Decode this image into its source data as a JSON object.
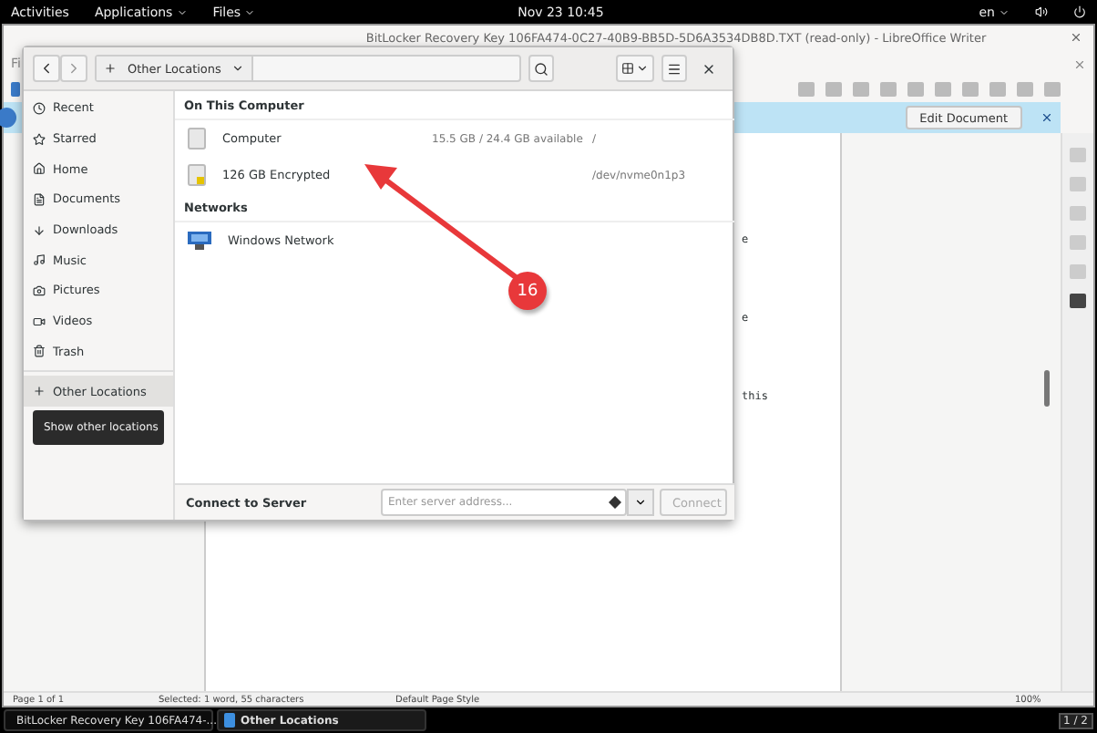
{
  "top_bar": {
    "activities": "Activities",
    "applications": "Applications",
    "app_menu": "Files",
    "clock": "Nov 23  10:45",
    "language": "en"
  },
  "writer": {
    "title": "BitLocker Recovery Key 106FA474-0C27-40B9-BB5D-5D6A3534DB8D.TXT (read-only) - LibreOffice Writer",
    "menu": "Fi",
    "infobar": {
      "button": "Edit Document"
    },
    "page_text": [
      "e",
      "e",
      "this"
    ],
    "status_bar": {
      "page": "Page 1 of 1",
      "selection": "Selected: 1 word, 55 characters",
      "style": "Default Page Style",
      "zoom": "100%"
    }
  },
  "files_dialog": {
    "path": "Other Locations",
    "sidebar": [
      {
        "label": "Recent",
        "selected": false
      },
      {
        "label": "Starred",
        "selected": false
      },
      {
        "label": "Home",
        "selected": false
      },
      {
        "label": "Documents",
        "selected": false
      },
      {
        "label": "Downloads",
        "selected": false
      },
      {
        "label": "Music",
        "selected": false
      },
      {
        "label": "Pictures",
        "selected": false
      },
      {
        "label": "Videos",
        "selected": false
      },
      {
        "label": "Trash",
        "selected": false
      },
      {
        "label": "Other Locations",
        "selected": true
      }
    ],
    "tooltip": "Show other locations",
    "sections": [
      {
        "title": "On This Computer",
        "items": [
          {
            "kind": "drive",
            "name": "Computer",
            "space": "15.5 GB / 24.4 GB available",
            "mount": "/"
          },
          {
            "kind": "locked-drive",
            "name": "126 GB Encrypted",
            "mount": "/dev/nvme0n1p3"
          }
        ]
      },
      {
        "title": "Networks",
        "items": [
          {
            "kind": "network",
            "name": "Windows Network"
          }
        ]
      }
    ],
    "connect": {
      "label": "Connect to Server",
      "placeholder": "Enter server address...",
      "button": "Connect",
      "button_disabled": true
    }
  },
  "annotation": {
    "number": "16"
  },
  "taskbar": [
    {
      "label": "BitLocker Recovery Key 106FA474-...",
      "selected": false
    },
    {
      "label": "Other Locations",
      "selected": true
    }
  ],
  "workspace": "1 / 2"
}
